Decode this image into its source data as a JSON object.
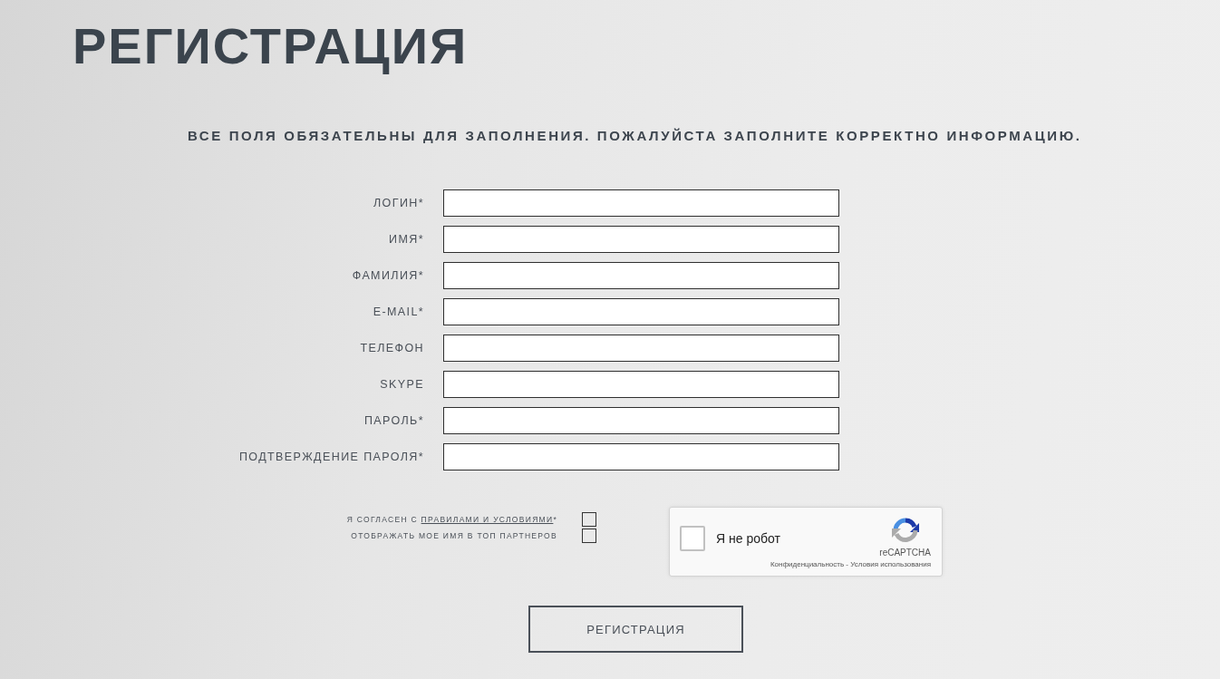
{
  "title": "РЕГИСТРАЦИЯ",
  "notice": "ВСЕ ПОЛЯ ОБЯЗАТЕЛЬНЫ ДЛЯ ЗАПОЛНЕНИЯ. ПОЖАЛУЙСТА ЗАПОЛНИТЕ КОРРЕКТНО ИНФОРМАЦИЮ.",
  "fields": [
    {
      "label": "ЛОГИН*"
    },
    {
      "label": "ИМЯ*"
    },
    {
      "label": "ФАМИЛИЯ*"
    },
    {
      "label": "E-MAIL*"
    },
    {
      "label": "ТЕЛЕФОН"
    },
    {
      "label": "SKYPE"
    },
    {
      "label": "ПАРОЛЬ*"
    },
    {
      "label": "ПОДТВЕРЖДЕНИЕ ПАРОЛЯ*"
    }
  ],
  "agreements": [
    {
      "text": "Я СОГЛАСЕН С",
      "link": "ПРАВИЛАМИ И УСЛОВИЯМИ",
      "suffix": "*",
      "checked": false
    },
    {
      "text": "ОТОБРАЖАТЬ МОЕ ИМЯ В ТОП ПАРТНЕРОВ",
      "checked": false
    }
  ],
  "captcha": {
    "label": "Я не робот",
    "checked": false,
    "brand": "reCAPTCHA",
    "links": [
      "Конфиденциальность",
      "Условия использования"
    ],
    "separator": "-"
  },
  "submit": "РЕГИСТРАЦИЯ"
}
